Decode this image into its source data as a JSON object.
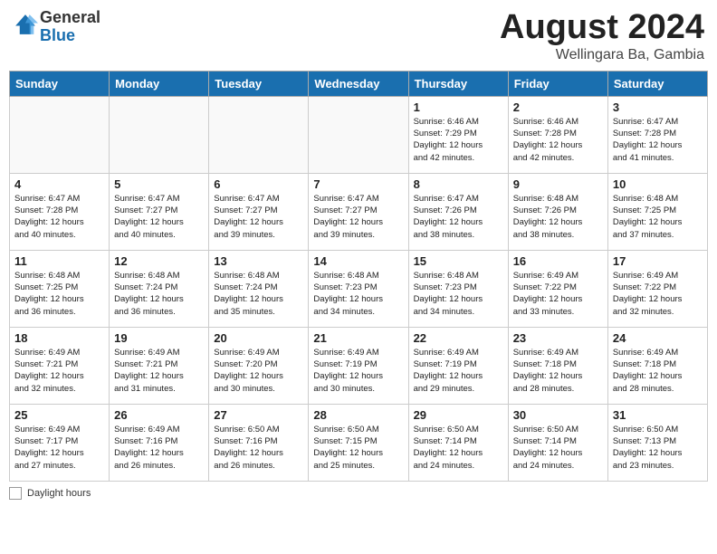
{
  "header": {
    "logo_general": "General",
    "logo_blue": "Blue",
    "month_title": "August 2024",
    "subtitle": "Wellingara Ba, Gambia"
  },
  "weekdays": [
    "Sunday",
    "Monday",
    "Tuesday",
    "Wednesday",
    "Thursday",
    "Friday",
    "Saturday"
  ],
  "footer": {
    "daylight_label": "Daylight hours"
  },
  "weeks": [
    [
      {
        "day": "",
        "info": ""
      },
      {
        "day": "",
        "info": ""
      },
      {
        "day": "",
        "info": ""
      },
      {
        "day": "",
        "info": ""
      },
      {
        "day": "1",
        "info": "Sunrise: 6:46 AM\nSunset: 7:29 PM\nDaylight: 12 hours\nand 42 minutes."
      },
      {
        "day": "2",
        "info": "Sunrise: 6:46 AM\nSunset: 7:28 PM\nDaylight: 12 hours\nand 42 minutes."
      },
      {
        "day": "3",
        "info": "Sunrise: 6:47 AM\nSunset: 7:28 PM\nDaylight: 12 hours\nand 41 minutes."
      }
    ],
    [
      {
        "day": "4",
        "info": "Sunrise: 6:47 AM\nSunset: 7:28 PM\nDaylight: 12 hours\nand 40 minutes."
      },
      {
        "day": "5",
        "info": "Sunrise: 6:47 AM\nSunset: 7:27 PM\nDaylight: 12 hours\nand 40 minutes."
      },
      {
        "day": "6",
        "info": "Sunrise: 6:47 AM\nSunset: 7:27 PM\nDaylight: 12 hours\nand 39 minutes."
      },
      {
        "day": "7",
        "info": "Sunrise: 6:47 AM\nSunset: 7:27 PM\nDaylight: 12 hours\nand 39 minutes."
      },
      {
        "day": "8",
        "info": "Sunrise: 6:47 AM\nSunset: 7:26 PM\nDaylight: 12 hours\nand 38 minutes."
      },
      {
        "day": "9",
        "info": "Sunrise: 6:48 AM\nSunset: 7:26 PM\nDaylight: 12 hours\nand 38 minutes."
      },
      {
        "day": "10",
        "info": "Sunrise: 6:48 AM\nSunset: 7:25 PM\nDaylight: 12 hours\nand 37 minutes."
      }
    ],
    [
      {
        "day": "11",
        "info": "Sunrise: 6:48 AM\nSunset: 7:25 PM\nDaylight: 12 hours\nand 36 minutes."
      },
      {
        "day": "12",
        "info": "Sunrise: 6:48 AM\nSunset: 7:24 PM\nDaylight: 12 hours\nand 36 minutes."
      },
      {
        "day": "13",
        "info": "Sunrise: 6:48 AM\nSunset: 7:24 PM\nDaylight: 12 hours\nand 35 minutes."
      },
      {
        "day": "14",
        "info": "Sunrise: 6:48 AM\nSunset: 7:23 PM\nDaylight: 12 hours\nand 34 minutes."
      },
      {
        "day": "15",
        "info": "Sunrise: 6:48 AM\nSunset: 7:23 PM\nDaylight: 12 hours\nand 34 minutes."
      },
      {
        "day": "16",
        "info": "Sunrise: 6:49 AM\nSunset: 7:22 PM\nDaylight: 12 hours\nand 33 minutes."
      },
      {
        "day": "17",
        "info": "Sunrise: 6:49 AM\nSunset: 7:22 PM\nDaylight: 12 hours\nand 32 minutes."
      }
    ],
    [
      {
        "day": "18",
        "info": "Sunrise: 6:49 AM\nSunset: 7:21 PM\nDaylight: 12 hours\nand 32 minutes."
      },
      {
        "day": "19",
        "info": "Sunrise: 6:49 AM\nSunset: 7:21 PM\nDaylight: 12 hours\nand 31 minutes."
      },
      {
        "day": "20",
        "info": "Sunrise: 6:49 AM\nSunset: 7:20 PM\nDaylight: 12 hours\nand 30 minutes."
      },
      {
        "day": "21",
        "info": "Sunrise: 6:49 AM\nSunset: 7:19 PM\nDaylight: 12 hours\nand 30 minutes."
      },
      {
        "day": "22",
        "info": "Sunrise: 6:49 AM\nSunset: 7:19 PM\nDaylight: 12 hours\nand 29 minutes."
      },
      {
        "day": "23",
        "info": "Sunrise: 6:49 AM\nSunset: 7:18 PM\nDaylight: 12 hours\nand 28 minutes."
      },
      {
        "day": "24",
        "info": "Sunrise: 6:49 AM\nSunset: 7:18 PM\nDaylight: 12 hours\nand 28 minutes."
      }
    ],
    [
      {
        "day": "25",
        "info": "Sunrise: 6:49 AM\nSunset: 7:17 PM\nDaylight: 12 hours\nand 27 minutes."
      },
      {
        "day": "26",
        "info": "Sunrise: 6:49 AM\nSunset: 7:16 PM\nDaylight: 12 hours\nand 26 minutes."
      },
      {
        "day": "27",
        "info": "Sunrise: 6:50 AM\nSunset: 7:16 PM\nDaylight: 12 hours\nand 26 minutes."
      },
      {
        "day": "28",
        "info": "Sunrise: 6:50 AM\nSunset: 7:15 PM\nDaylight: 12 hours\nand 25 minutes."
      },
      {
        "day": "29",
        "info": "Sunrise: 6:50 AM\nSunset: 7:14 PM\nDaylight: 12 hours\nand 24 minutes."
      },
      {
        "day": "30",
        "info": "Sunrise: 6:50 AM\nSunset: 7:14 PM\nDaylight: 12 hours\nand 24 minutes."
      },
      {
        "day": "31",
        "info": "Sunrise: 6:50 AM\nSunset: 7:13 PM\nDaylight: 12 hours\nand 23 minutes."
      }
    ]
  ]
}
